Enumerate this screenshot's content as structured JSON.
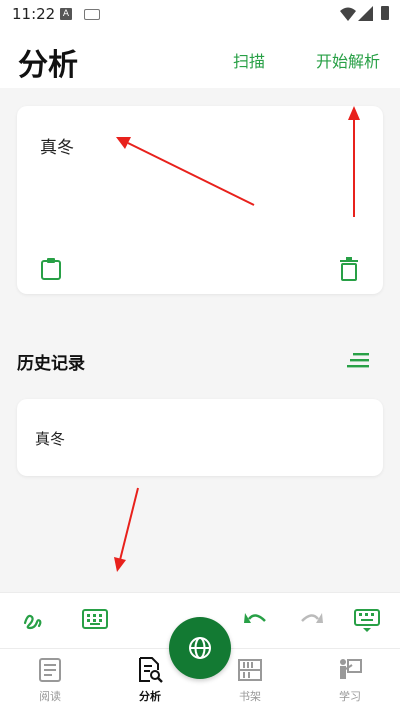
{
  "status_bar": {
    "time": "11:22",
    "a_label": "A"
  },
  "header": {
    "title": "分析",
    "scan_label": "扫描",
    "parse_label": "开始解析"
  },
  "input_card": {
    "text": "真冬"
  },
  "history": {
    "title": "历史记录",
    "items": [
      {
        "text": "真冬"
      }
    ]
  },
  "tabs": [
    {
      "label": "阅读",
      "active": false
    },
    {
      "label": "分析",
      "active": true
    },
    {
      "label": "书架",
      "active": false
    },
    {
      "label": "学习",
      "active": false
    }
  ],
  "colors": {
    "accent": "#28a046",
    "fab": "#137a33",
    "arrow": "#e8211c"
  }
}
